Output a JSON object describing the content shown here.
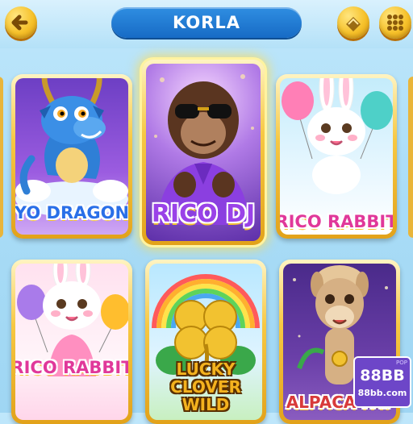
{
  "header": {
    "title": "KORLA",
    "back_icon": "arrow-left-icon",
    "right_icons": [
      "chevron-down-icon",
      "grid-icon"
    ]
  },
  "games": [
    {
      "name": "YO DRAGON",
      "art": "blue-dragon-icon",
      "label_color": "#2a6fe8"
    },
    {
      "name": "RICO DJ",
      "art": "gorilla-dj-icon",
      "label_color": "#8a3fe0",
      "selected": true
    },
    {
      "name": "RICO RABBIT",
      "art": "white-rabbit-balloons-icon",
      "label_color": "#e0389a"
    },
    {
      "name": "RICO RABBIT",
      "art": "bunny-pink-dress-icon",
      "label_color": "#e0389a"
    },
    {
      "name": "LUCKY CLOVER WILD",
      "art": "golden-clover-icon",
      "label_color": "#f2a81c"
    },
    {
      "name": "ALPACA FAT",
      "art": "alpaca-icon",
      "label_color": "#d83a3a"
    }
  ],
  "watermark": {
    "brand": "88BB",
    "url": "88bb.com",
    "tag": "POP"
  }
}
